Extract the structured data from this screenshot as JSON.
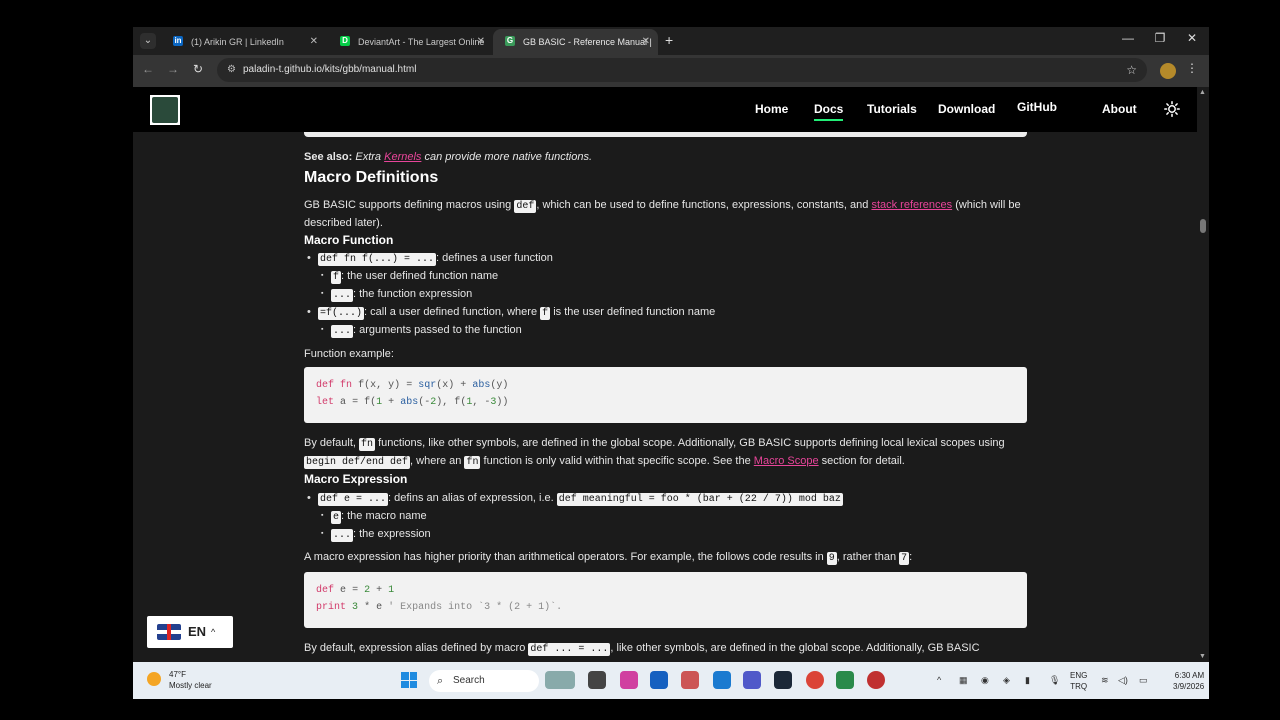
{
  "browser": {
    "tabs": [
      {
        "title": "(1) Arikin GR | LinkedIn",
        "icon": "linkedin-icon",
        "color": "#0a66c2",
        "glyph": "in"
      },
      {
        "title": "DeviantArt - The Largest Online",
        "icon": "deviantart-icon",
        "color": "#05cc47",
        "glyph": "D"
      },
      {
        "title": "GB BASIC - Reference Manual |",
        "icon": "gbbasic-icon",
        "color": "#3a9a5a",
        "glyph": "G"
      }
    ],
    "url": "paladin-t.github.io/kits/gbb/manual.html"
  },
  "site": {
    "nav": [
      "Home",
      "Docs",
      "Tutorials",
      "Download",
      "GitHub",
      "About"
    ],
    "active_nav": "Docs"
  },
  "doc": {
    "see_also_label": "See also:",
    "see_also_pre": " Extra ",
    "see_also_link": "Kernels",
    "see_also_post": " can provide more native functions.",
    "h_macro_defs": "Macro Definitions",
    "p1_a": "GB BASIC supports defining macros using ",
    "p1_code": "def",
    "p1_b": ", which can be used to define functions, expressions, constants, and ",
    "p1_link": "stack references",
    "p1_c": " (which will be",
    "p1_d": "described later).",
    "h_macro_fn": "Macro Function",
    "b1_code": "def fn f(...) = ...",
    "b1_text": ": defines a user function",
    "b1a_code": "f",
    "b1a_text": ": the user defined function name",
    "b1b_code": "...",
    "b1b_text": ": the function expression",
    "b2_code": "=f(...)",
    "b2_text_a": ": call a user defined function, where ",
    "b2_code2": "f",
    "b2_text_b": " is the user defined function name",
    "b2a_code": "...",
    "b2a_text": ": arguments passed to the function",
    "fn_example": "Function example:",
    "code1": [
      "def fn f(x, y) = sqr(x) + abs(y)",
      "let a = f(1 + abs(-2), f(1, -3))"
    ],
    "p2_a": "By default, ",
    "p2_code": "fn",
    "p2_b": " functions, like other symbols, are defined in the global scope. Additionally, GB BASIC supports defining local lexical scopes using",
    "p2_code2": "begin def/end def",
    "p2_c": ", where an ",
    "p2_code3": "fn",
    "p2_d": " function is only valid within that specific scope. See the ",
    "p2_link": "Macro Scope",
    "p2_e": " section for detail.",
    "h_macro_expr": "Macro Expression",
    "b3_code": "def e = ...",
    "b3_text": ": defins an alias of expression, i.e. ",
    "b3_code2": "def meaningful = foo * (bar + (22 / 7)) mod baz",
    "b3a_code": "e",
    "b3a_text": ": the macro name",
    "b3b_code": "...",
    "b3b_text": ": the expression",
    "p3_a": "A macro expression has higher priority than arithmetical operators. For example, the follows code results in ",
    "p3_code": "9",
    "p3_b": ", rather than ",
    "p3_code2": "7",
    "p3_c": ":",
    "code2": [
      "def e = 2 + 1",
      "print 3 * e ' Expands into `3 * (2 + 1)`."
    ],
    "p4_a": "By default, expression alias defined by macro ",
    "p4_code": "def ... = ...",
    "p4_b": ", like other symbols, are defined in the global scope. Additionally, GB BASIC"
  },
  "language_widget": {
    "code": "EN"
  },
  "taskbar": {
    "weather_temp": "47°F",
    "weather_desc": "Mostly clear",
    "search_placeholder": "Search",
    "lang_top": "ENG",
    "lang_bottom": "TRQ",
    "time": "6:30 AM",
    "date": "3/9/2026"
  }
}
